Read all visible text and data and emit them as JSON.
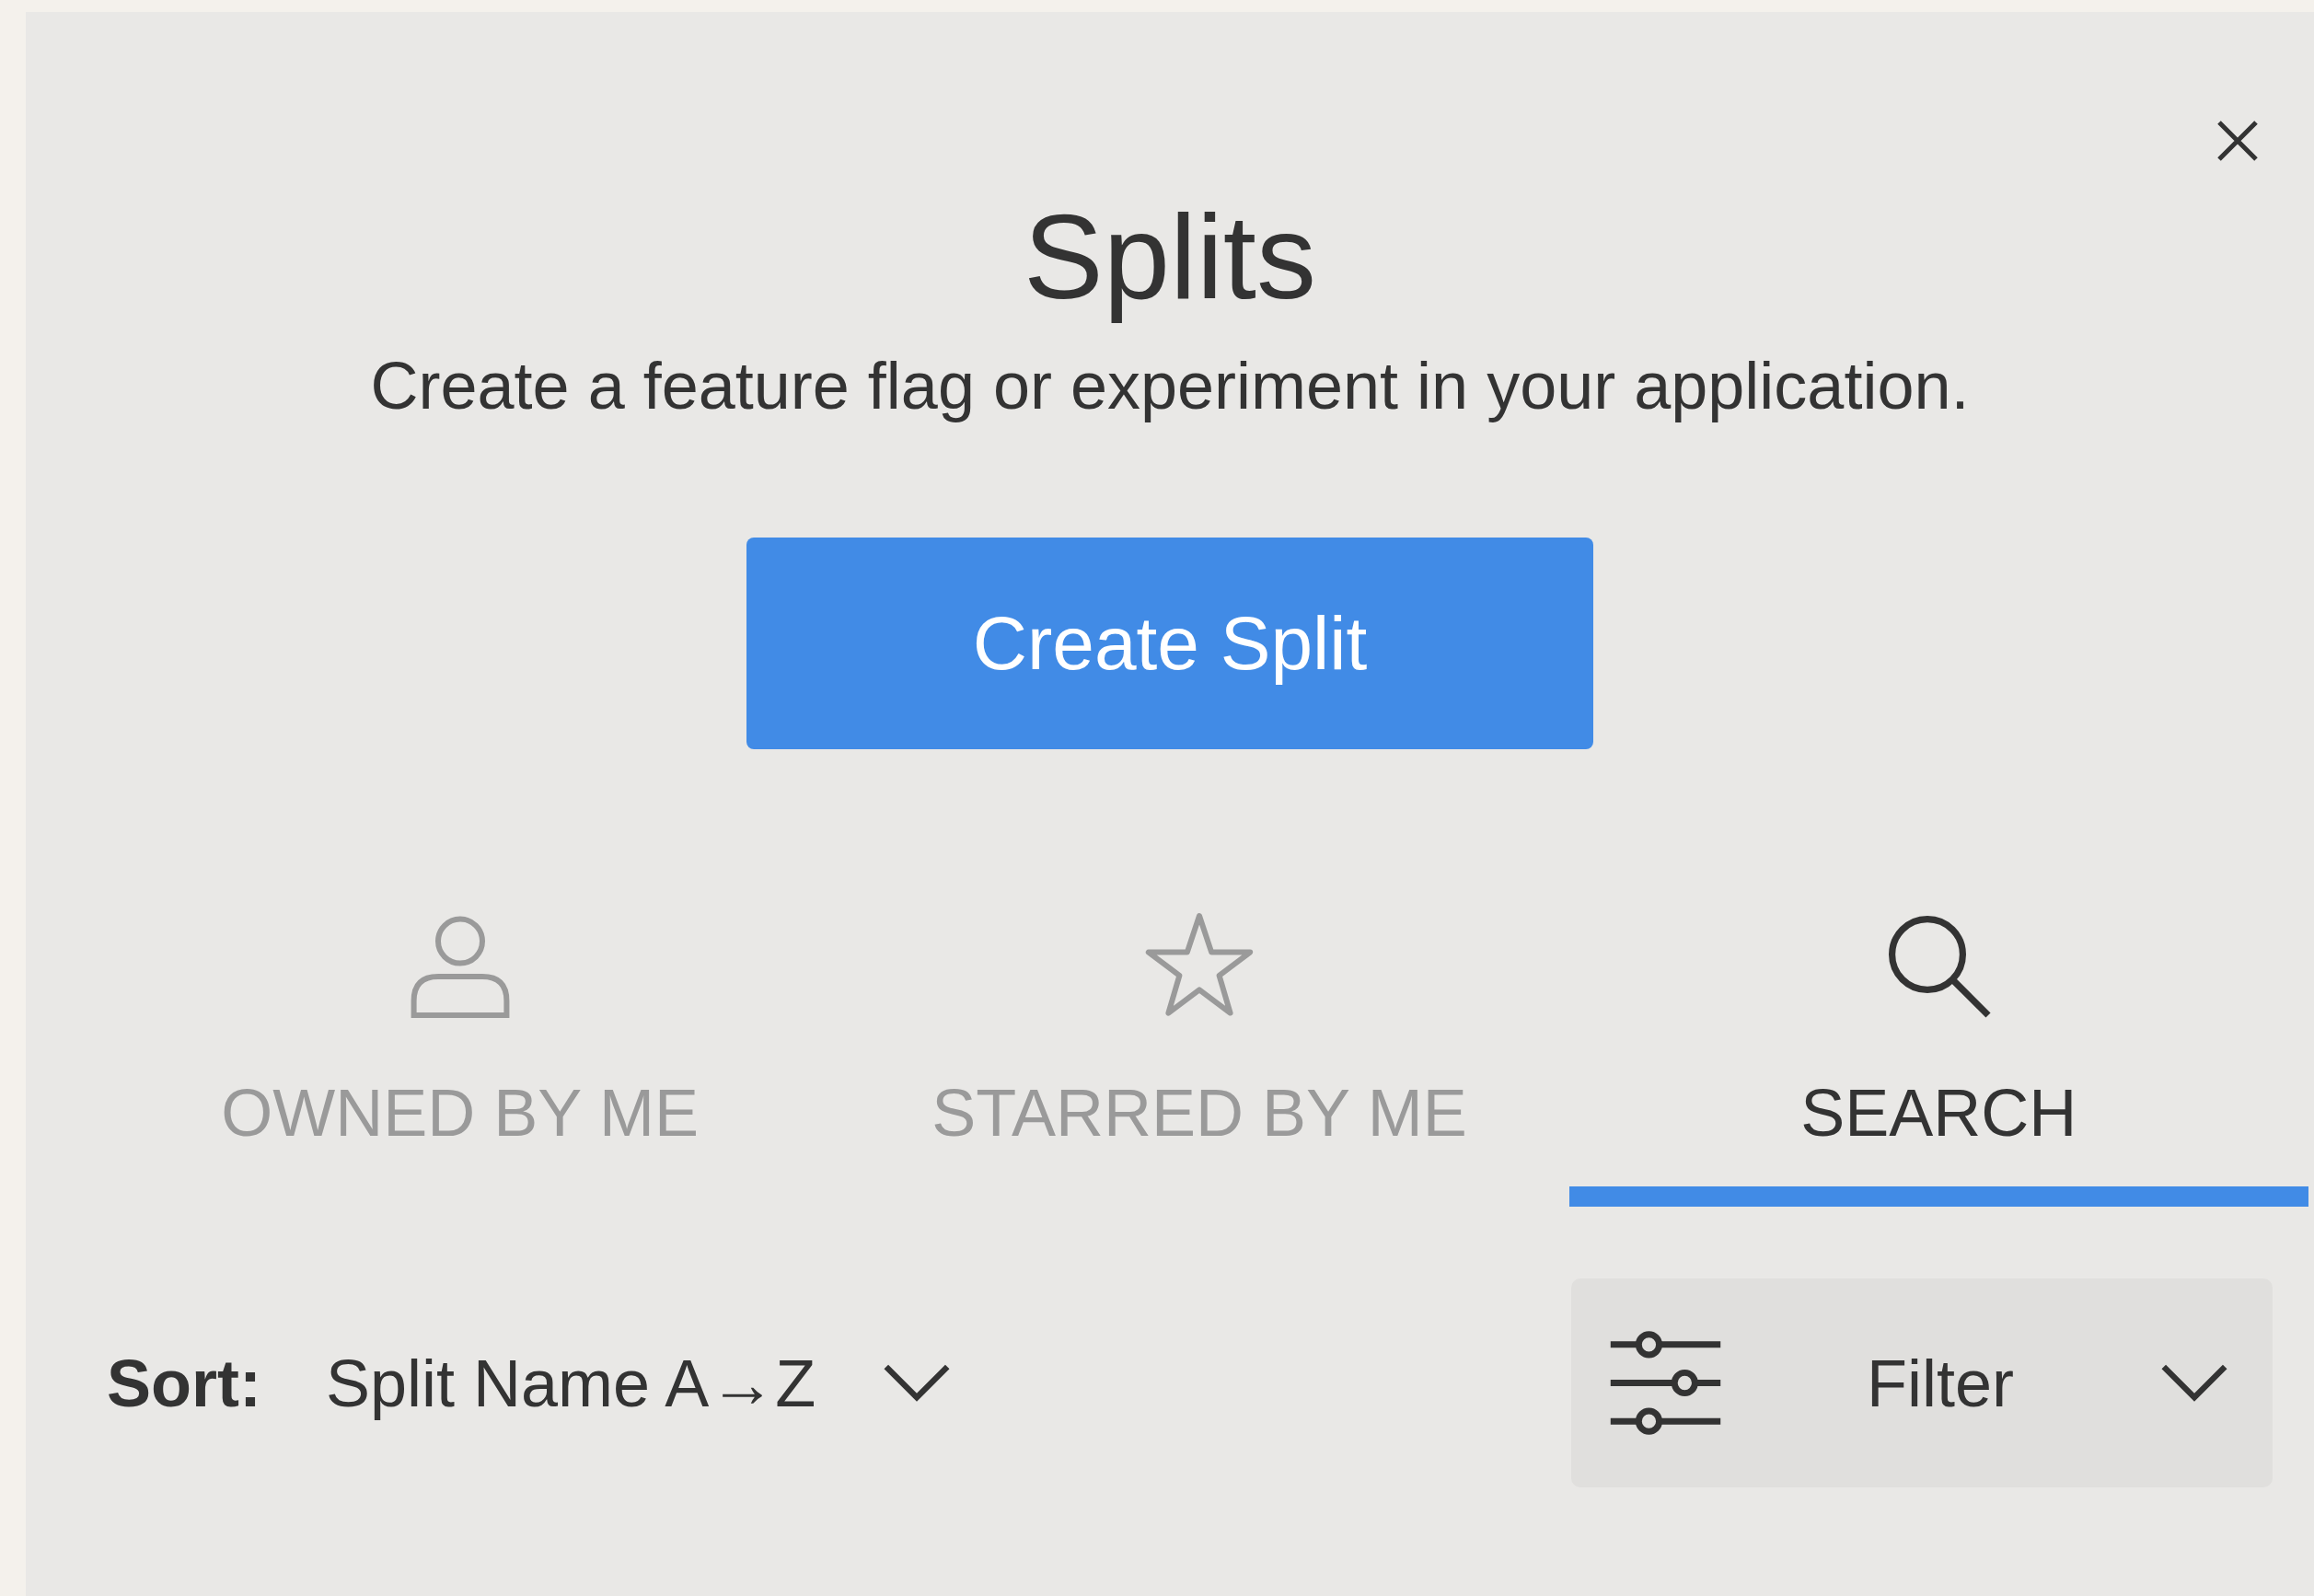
{
  "title": "Splits",
  "subtitle": "Create a feature flag or experiment in your application.",
  "create_button": "Create Split",
  "tabs": [
    {
      "label": "OWNED BY ME",
      "selected": false
    },
    {
      "label": "STARRED BY ME",
      "selected": false
    },
    {
      "label": "SEARCH",
      "selected": true
    }
  ],
  "sort": {
    "label": "Sort:",
    "value": "Split Name A→Z"
  },
  "filter": {
    "label": "Filter"
  }
}
